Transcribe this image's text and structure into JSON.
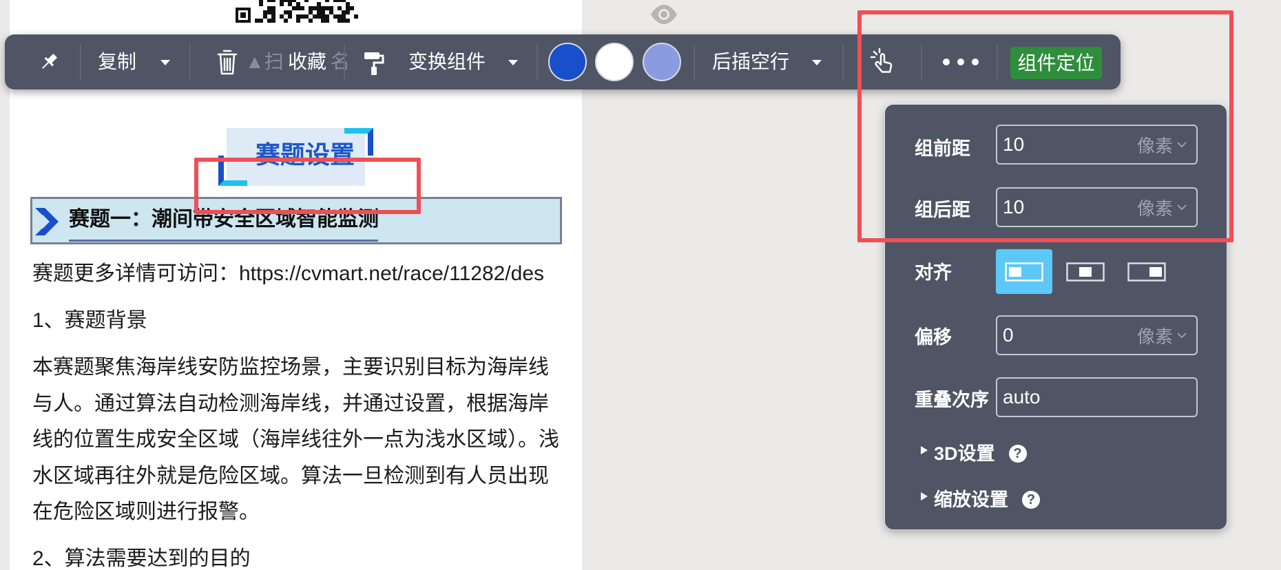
{
  "toolbar": {
    "pin_icon": "pin-icon",
    "copy_label": "复制",
    "delete_icon": "trash-icon",
    "underlying_text_fragments": [
      "▲扫",
      "名"
    ],
    "favorite_label": "收藏",
    "format_painter_icon": "paint-roller-icon",
    "transform_label": "变换组件",
    "color_swatches": [
      "#1a4fcc",
      "#ffffff",
      "#8b9be0"
    ],
    "insert_label": "后插空行",
    "interaction_icon": "tap-hand-icon",
    "more_icon": "more-dots-icon",
    "locate_label": "组件定位",
    "locate_color": "#2f8e3c"
  },
  "preview_icon": "eye-icon",
  "article": {
    "qr_code": "qr-code-image",
    "banner_title": "赛题设置",
    "section_icon": "double-chevron-icon",
    "section_title": "赛题一：潮间带安全区域智能监测",
    "link_line": "赛题更多详情可访问：https://cvmart.net/race/11282/des",
    "heading_1": "1、赛题背景",
    "paragraph_lines": [
      "本赛题聚焦海岸线安防监控场景，主要识别目标为海岸线",
      "与人。通过算法自动检测海岸线，并通过设置，根据海岸",
      "线的位置生成安全区域（海岸线往外一点为浅水区域）。浅",
      "水区域再往外就是危险区域。算法一旦检测到有人员出现",
      "在危险区域则进行报警。"
    ],
    "heading_2": "2、算法需要达到的目的"
  },
  "position_panel": {
    "margin_top": {
      "label": "组前距",
      "value": "10",
      "unit": "像素"
    },
    "margin_bottom": {
      "label": "组后距",
      "value": "10",
      "unit": "像素"
    },
    "align": {
      "label": "对齐",
      "options": [
        "align-left-icon",
        "align-center-icon",
        "align-right-icon"
      ],
      "selected": "align-left-icon"
    },
    "offset": {
      "label": "偏移",
      "value": "0",
      "unit": "像素"
    },
    "z_order": {
      "label": "重叠次序",
      "value": "auto"
    },
    "collapsibles": [
      {
        "label": "3D设置",
        "help": "?"
      },
      {
        "label": "缩放设置",
        "help": "?"
      }
    ]
  },
  "theme": {
    "toolbar_bg": "#4f5564",
    "annotation_color": "#ef4f56",
    "selected_align_bg": "#5bc8f8"
  }
}
